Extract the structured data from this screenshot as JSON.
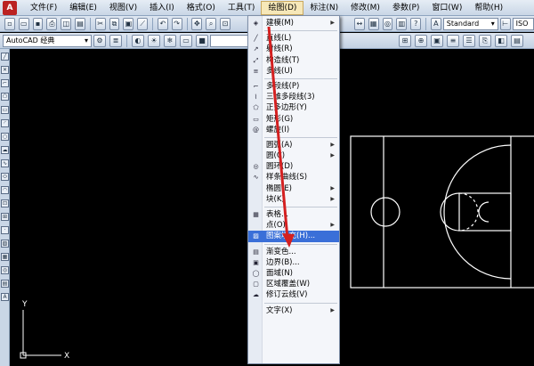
{
  "menubar": {
    "items": [
      "文件(F)",
      "编辑(E)",
      "视图(V)",
      "插入(I)",
      "格式(O)",
      "工具(T)",
      "绘图(D)",
      "标注(N)",
      "修改(M)",
      "参数(P)",
      "窗口(W)",
      "帮助(H)"
    ],
    "active_index": 6
  },
  "toolbar": {
    "text_style": "Standard",
    "dim_style": "ISO",
    "workspace": "AutoCAD 经典"
  },
  "draw_menu": {
    "items": [
      {
        "label": "建模(M)",
        "icon": "modeling-icon",
        "submenu": true
      },
      {
        "sep": true
      },
      {
        "label": "直线(L)",
        "icon": "line-icon"
      },
      {
        "label": "射线(R)",
        "icon": "ray-icon"
      },
      {
        "label": "构造线(T)",
        "icon": "xline-icon"
      },
      {
        "label": "多线(U)",
        "icon": "multiline-icon"
      },
      {
        "sep": true
      },
      {
        "label": "多段线(P)",
        "icon": "polyline-icon"
      },
      {
        "label": "三维多段线(3)",
        "icon": "3d-polyline-icon"
      },
      {
        "label": "正多边形(Y)",
        "icon": "polygon-icon"
      },
      {
        "label": "矩形(G)",
        "icon": "rectangle-icon"
      },
      {
        "label": "螺旋(I)",
        "icon": "helix-icon"
      },
      {
        "sep": true
      },
      {
        "label": "圆弧(A)",
        "icon": "",
        "submenu": true
      },
      {
        "label": "圆(C)",
        "icon": "",
        "submenu": true
      },
      {
        "label": "圆环(D)",
        "icon": "donut-icon"
      },
      {
        "label": "样条曲线(S)",
        "icon": "spline-icon"
      },
      {
        "label": "椭圆(E)",
        "icon": "",
        "submenu": true
      },
      {
        "label": "块(K)",
        "icon": "",
        "submenu": true
      },
      {
        "sep": true
      },
      {
        "label": "表格...",
        "icon": "table-icon"
      },
      {
        "label": "点(O)",
        "icon": "",
        "submenu": true
      },
      {
        "label": "图案填充(H)...",
        "icon": "hatch-icon",
        "highlighted": true
      },
      {
        "sep": true
      },
      {
        "label": "渐变色...",
        "icon": "gradient-icon"
      },
      {
        "label": "边界(B)...",
        "icon": "boundary-icon"
      },
      {
        "label": "面域(N)",
        "icon": "region-icon"
      },
      {
        "label": "区域覆盖(W)",
        "icon": "wipeout-icon"
      },
      {
        "label": "修订云线(V)",
        "icon": "revcloud-icon"
      },
      {
        "sep": true
      },
      {
        "label": "文字(X)",
        "icon": "",
        "submenu": true
      }
    ]
  },
  "ucs": {
    "x_label": "X",
    "y_label": "Y"
  },
  "colors": {
    "accent": "#3a6fd8",
    "arrow": "#d42020",
    "court_lines": "#ffffff"
  }
}
